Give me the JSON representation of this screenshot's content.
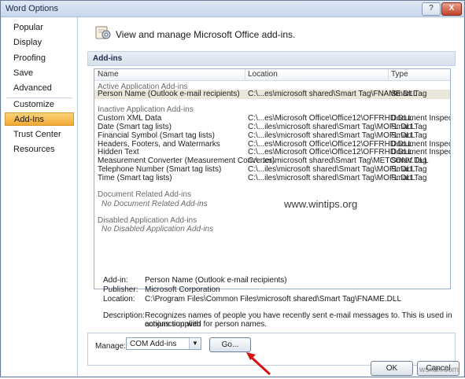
{
  "window": {
    "title": "Word Options",
    "help_glyph": "?",
    "close_glyph": "X"
  },
  "sidebar": {
    "items": [
      {
        "label": "Popular"
      },
      {
        "label": "Display"
      },
      {
        "label": "Proofing"
      },
      {
        "label": "Save"
      },
      {
        "label": "Advanced"
      },
      {
        "label": "Customize"
      },
      {
        "label": "Add-Ins",
        "active": true
      },
      {
        "label": "Trust Center"
      },
      {
        "label": "Resources"
      }
    ]
  },
  "header": {
    "text": "View and manage Microsoft Office add-ins."
  },
  "section": {
    "title": "Add-ins"
  },
  "list": {
    "columns": [
      "Name",
      "Location",
      "Type"
    ],
    "groups": {
      "active": "Active Application Add-ins",
      "inactive": "Inactive Application Add-ins",
      "document": "Document Related Add-ins",
      "disabled": "Disabled Application Add-ins"
    },
    "active_rows": [
      [
        "Person Name (Outlook e-mail recipients)",
        "C:\\...es\\microsoft shared\\Smart Tag\\FNAME.DLL",
        "Smart Tag"
      ]
    ],
    "inactive_rows": [
      [
        "Custom XML Data",
        "C:\\...es\\Microsoft Office\\Office12\\OFFRHD.DLL",
        "Document Inspector"
      ],
      [
        "Date (Smart tag lists)",
        "C:\\...iles\\microsoft shared\\Smart Tag\\MOFL.DLL",
        "Smart Tag"
      ],
      [
        "Financial Symbol (Smart tag lists)",
        "C:\\...iles\\microsoft shared\\Smart Tag\\MOFL.DLL",
        "Smart Tag"
      ],
      [
        "Headers, Footers, and Watermarks",
        "C:\\...es\\Microsoft Office\\Office12\\OFFRHD.DLL",
        "Document Inspector"
      ],
      [
        "Hidden Text",
        "C:\\...es\\Microsoft Office\\Office12\\OFFRHD.DLL",
        "Document Inspector"
      ],
      [
        "Measurement Converter (Measurement Converter)",
        "C:\\...es\\microsoft shared\\Smart Tag\\METCONV.DLL",
        "Smart Tag"
      ],
      [
        "Telephone Number (Smart tag lists)",
        "C:\\...iles\\microsoft shared\\Smart Tag\\MOFL.DLL",
        "Smart Tag"
      ],
      [
        "Time (Smart tag lists)",
        "C:\\...iles\\microsoft shared\\Smart Tag\\MOFL.DLL",
        "Smart Tag"
      ]
    ],
    "document_empty": "No Document Related Add-ins",
    "disabled_empty": "No Disabled Application Add-ins"
  },
  "details": {
    "addin_label": "Add-in:",
    "addin_value": "Person Name (Outlook e-mail recipients)",
    "publisher_label": "Publisher:",
    "publisher_value": "Microsoft Corporation",
    "location_label": "Location:",
    "location_value": "C:\\Program Files\\Common Files\\microsoft shared\\Smart Tag\\FNAME.DLL",
    "description_label": "Description:",
    "description_line1": "Recognizes names of people you have recently sent e-mail messages to. This is used in conjunction with",
    "description_line2": "actions supplied for person names."
  },
  "manage": {
    "label": "Manage:",
    "selected": "COM Add-ins",
    "go_label": "Go..."
  },
  "footer": {
    "ok_label": "OK",
    "cancel_label": "Cancel"
  },
  "watermark": {
    "text": "www.wintips.org",
    "corner": "wsxdn.com"
  }
}
